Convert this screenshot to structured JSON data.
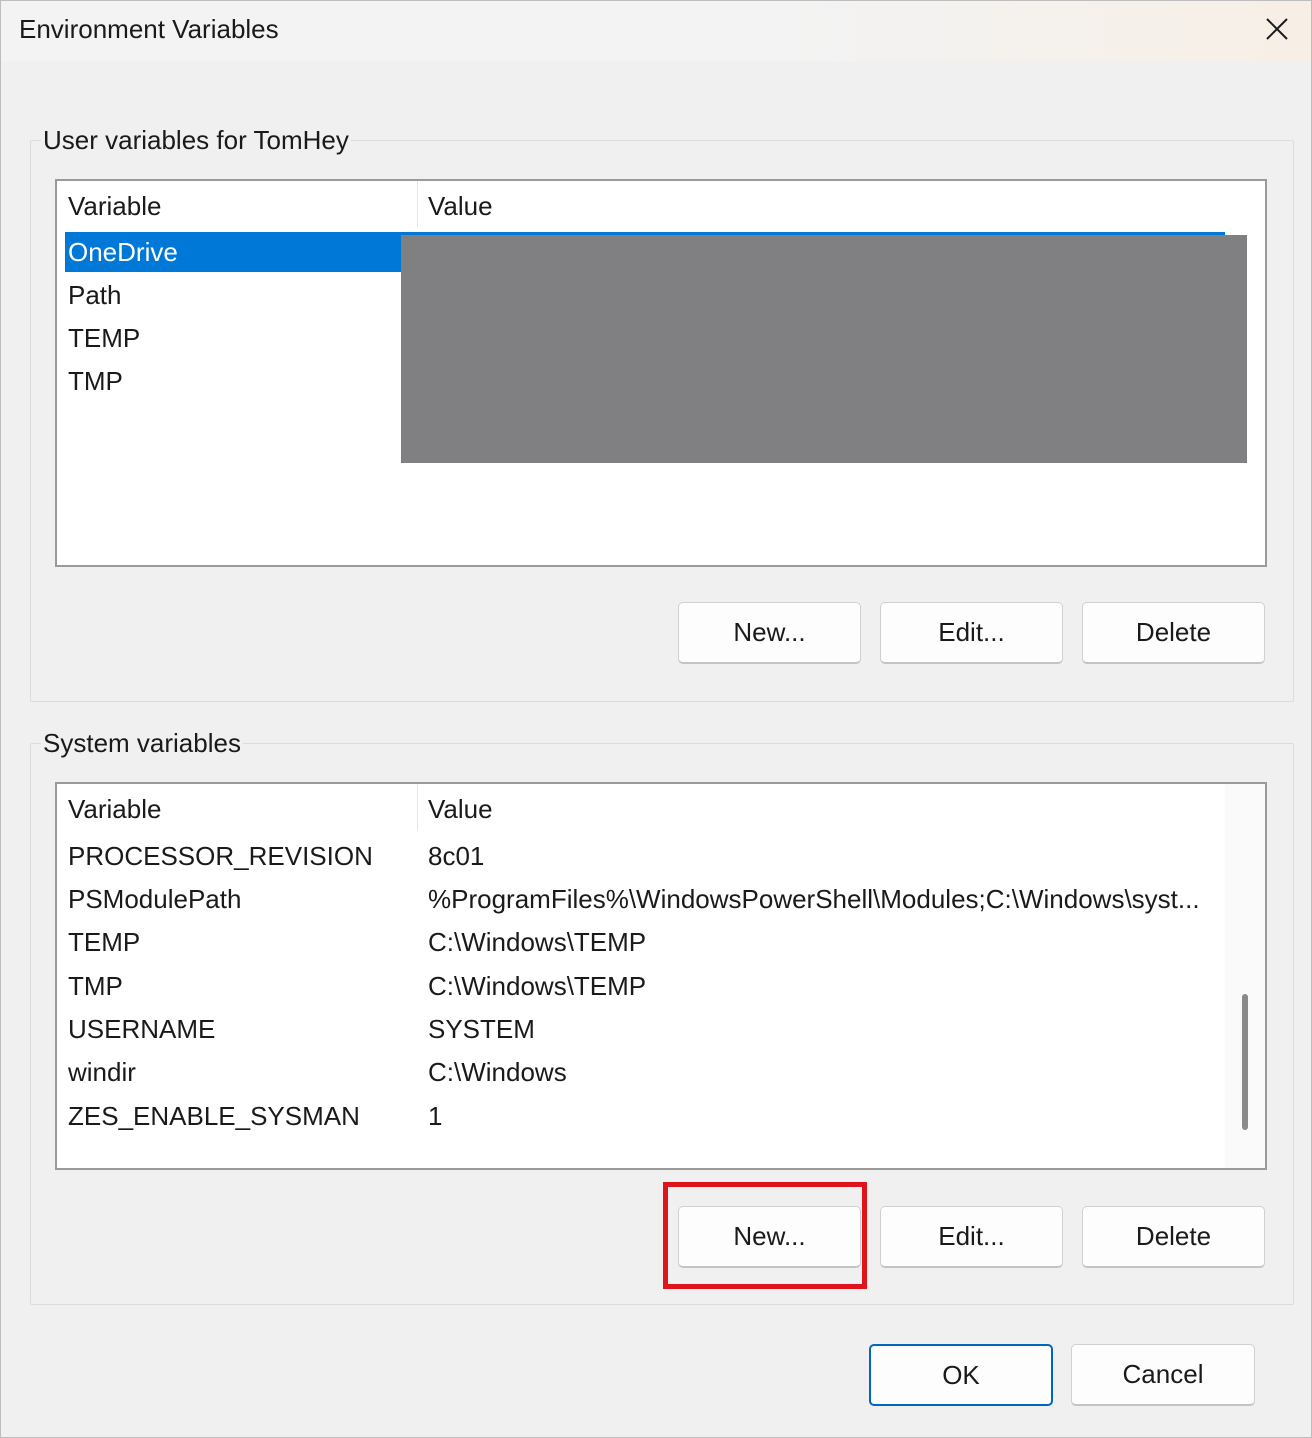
{
  "window": {
    "title": "Environment Variables"
  },
  "user_vars": {
    "group_label": "User variables for TomHey",
    "columns": [
      "Variable",
      "Value"
    ],
    "rows": [
      {
        "name": "OneDrive",
        "value": ""
      },
      {
        "name": "Path",
        "value": ""
      },
      {
        "name": "TEMP",
        "value": ""
      },
      {
        "name": "TMP",
        "value": ""
      }
    ],
    "selected_index": 0,
    "buttons": {
      "new": "New...",
      "edit": "Edit...",
      "delete": "Delete"
    }
  },
  "system_vars": {
    "group_label": "System variables",
    "columns": [
      "Variable",
      "Value"
    ],
    "rows": [
      {
        "name": "PROCESSOR_REVISION",
        "value": "8c01"
      },
      {
        "name": "PSModulePath",
        "value": "%ProgramFiles%\\WindowsPowerShell\\Modules;C:\\Windows\\syst..."
      },
      {
        "name": "TEMP",
        "value": "C:\\Windows\\TEMP"
      },
      {
        "name": "TMP",
        "value": "C:\\Windows\\TEMP"
      },
      {
        "name": "USERNAME",
        "value": "SYSTEM"
      },
      {
        "name": "windir",
        "value": "C:\\Windows"
      },
      {
        "name": "ZES_ENABLE_SYSMAN",
        "value": "1"
      }
    ],
    "buttons": {
      "new": "New...",
      "edit": "Edit...",
      "delete": "Delete"
    },
    "highlighted_button": "new"
  },
  "dialog_buttons": {
    "ok": "OK",
    "cancel": "Cancel"
  },
  "colors": {
    "selection": "#0078d7",
    "highlight": "#e0141d",
    "redaction": "#808083",
    "default_button_border": "#0067c0"
  },
  "icons": {
    "close": "close-icon"
  }
}
